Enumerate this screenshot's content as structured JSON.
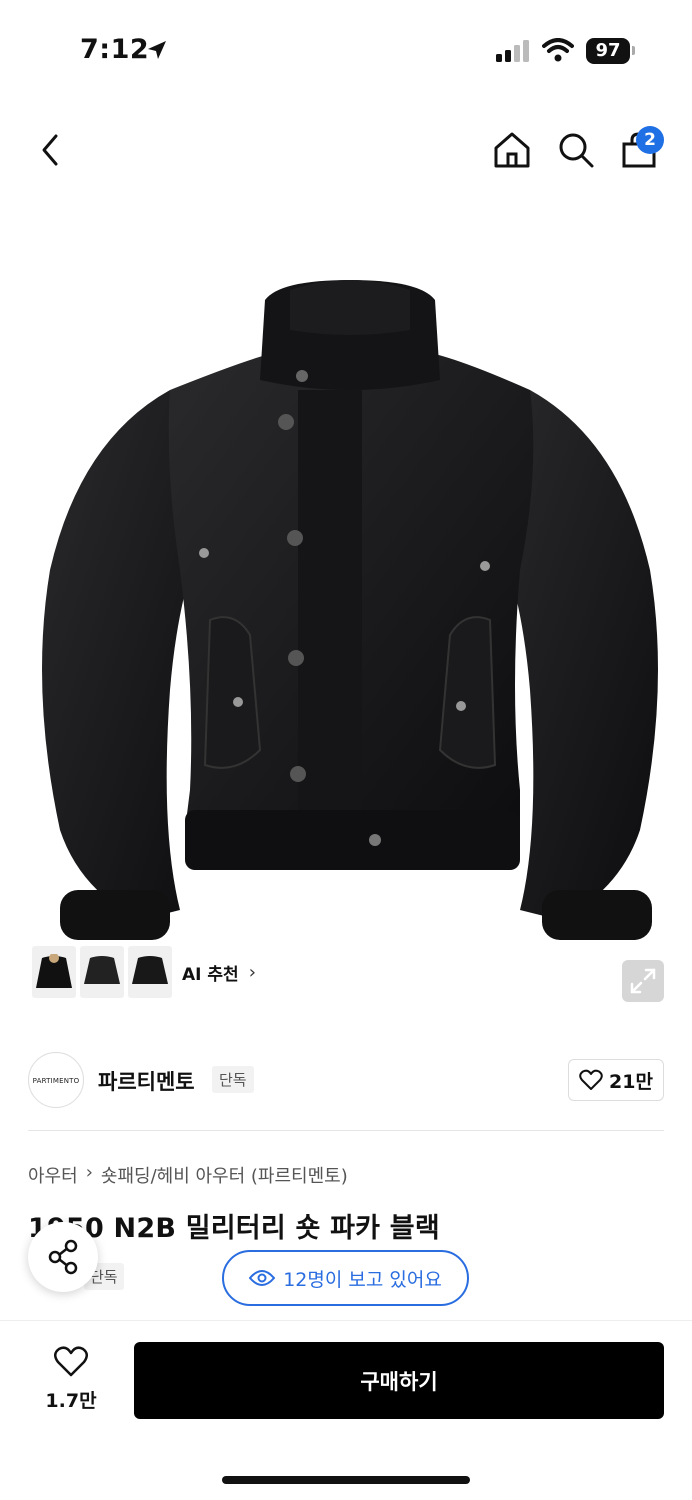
{
  "status_bar": {
    "time": "7:12",
    "battery": "97"
  },
  "nav": {
    "cart_count": "2"
  },
  "ai_recommend": {
    "label": "AI 추천"
  },
  "brand": {
    "logo_text": "PARTIMENTO",
    "name": "파르티멘토",
    "tag": "단독",
    "likes": "21만"
  },
  "product": {
    "breadcrumb": [
      "아우터",
      "숏패딩/헤비 아우터 (파르티멘토)"
    ],
    "title": "1950 N2B 밀리터리 숏 파카 블랙",
    "tag": "단독",
    "viewers": "12명이 보고 있어요"
  },
  "bottom": {
    "wish_count": "1.7만",
    "buy_label": "구매하기"
  },
  "colors": {
    "accent_blue": "#2a6de0",
    "badge_blue": "#1f6fe5",
    "button_black": "#000000"
  }
}
